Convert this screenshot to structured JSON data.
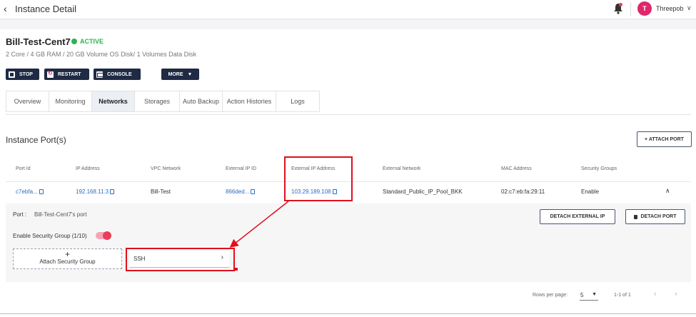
{
  "header": {
    "back_icon": "chevron-left-icon",
    "title": "Instance Detail",
    "user_initial": "T",
    "user_name": "Threepob",
    "accent": "#e0266d"
  },
  "instance": {
    "name": "Bill-Test-Cent7",
    "status": "ACTIVE",
    "status_color": "#2bb44a",
    "spec": "2 Core / 4 GB RAM / 20 GB Volume OS Disk/ 1 Volumes Data Disk"
  },
  "actions": {
    "stop": "STOP",
    "restart": "RESTART",
    "console": "CONSOLE",
    "more": "MORE"
  },
  "tabs": [
    "Overview",
    "Monitoring",
    "Networks",
    "Storages",
    "Auto Backup",
    "Action Histories",
    "Logs"
  ],
  "active_tab": "Networks",
  "ports_section": {
    "title": "Instance Port(s)",
    "attach_button": "+ ATTACH PORT",
    "columns": [
      "Port Id",
      "IP Address",
      "VPC Network",
      "External IP ID",
      "External IP Address",
      "External Network",
      "MAC Address",
      "Security Groups"
    ],
    "rows": [
      {
        "port_id": "c7ebfa...",
        "ip_address": "192.168.11.3",
        "vpc_network": "Bill-Test",
        "external_ip_id": "866ded...",
        "external_ip_address": "103.29.189.108",
        "external_network": "Standard_Public_IP_Pool_BKK",
        "mac_address": "02:c7:eb:fa:29:11",
        "security_groups": "Enable"
      }
    ]
  },
  "port_detail": {
    "port_label": "Port :",
    "port_value": "Bill-Test-Cent7's port",
    "detach_external_ip": "DETACH EXTERNAL IP",
    "detach_port": "DETACH PORT",
    "security_group_label": "Enable Security Group (1/10)",
    "security_group_enabled": true,
    "attach_security_group": "Attach Security Group",
    "attach_plus": "+",
    "security_groups": [
      "SSH"
    ]
  },
  "pagination": {
    "rows_per_page_label": "Rows per page:",
    "rows_per_page": "5",
    "range": "1-1 of 1"
  },
  "annotation_color": "#e0101e"
}
